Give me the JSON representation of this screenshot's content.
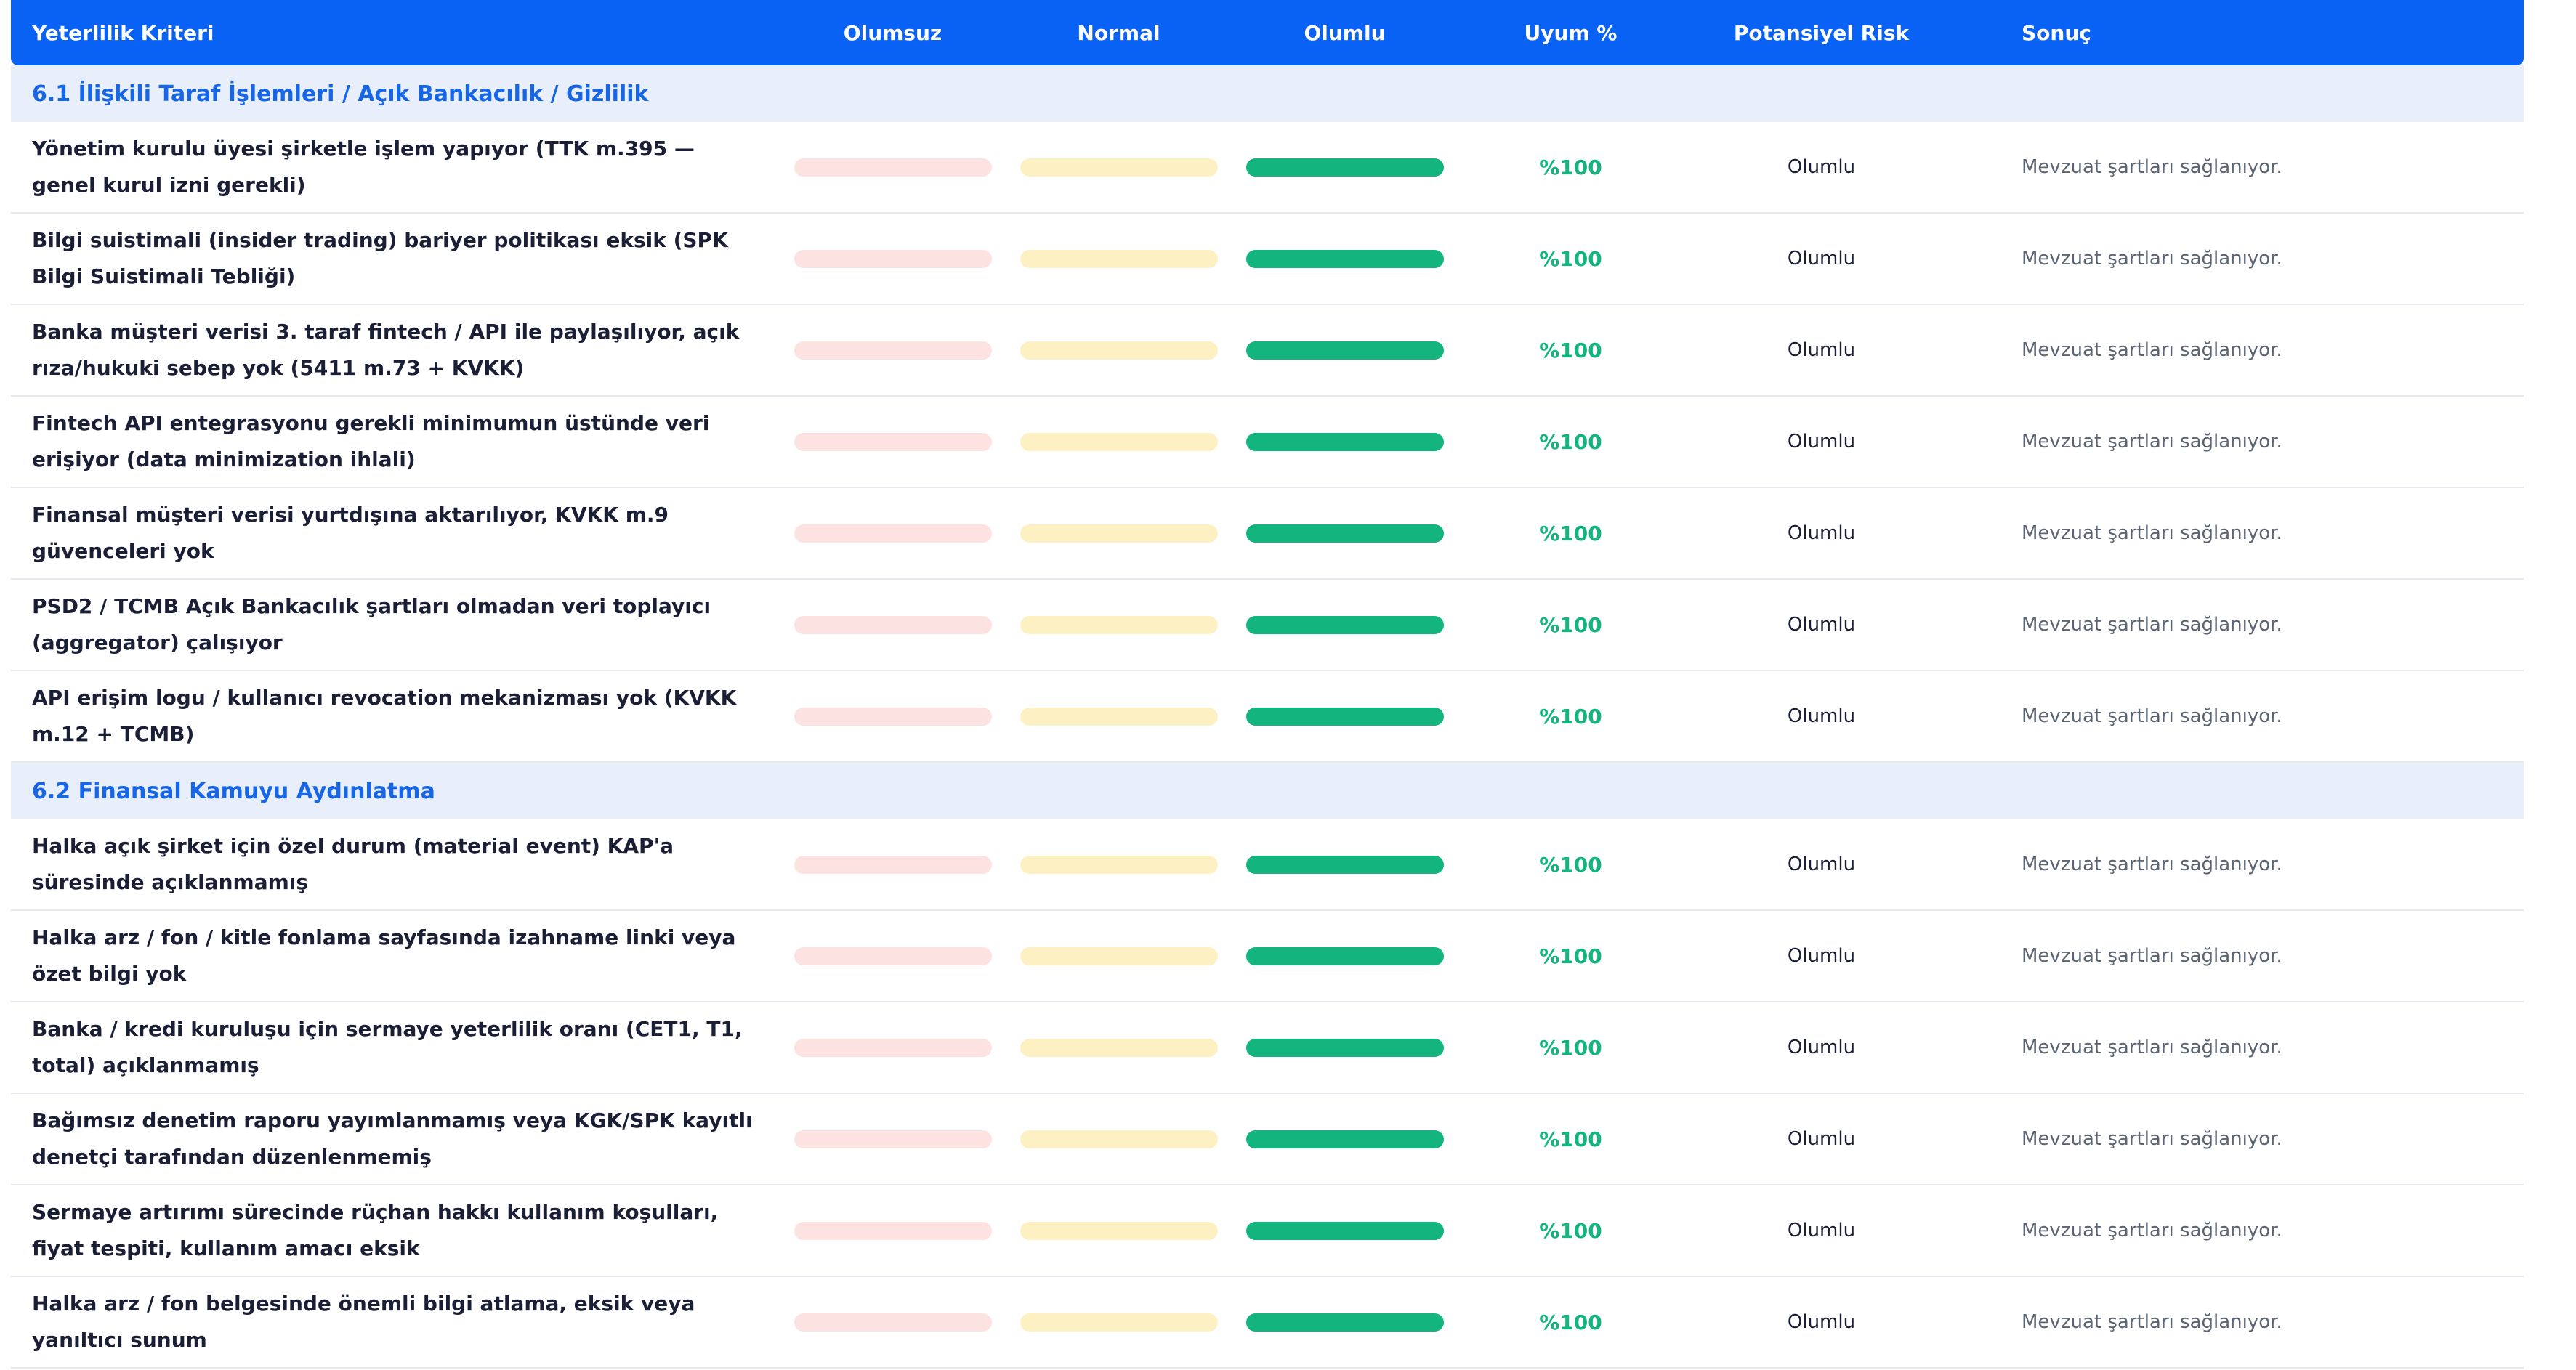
{
  "header": {
    "criteria": "Yeterlilik Kriteri",
    "negative": "Olumsuz",
    "normal": "Normal",
    "positive": "Olumlu",
    "compliance": "Uyum %",
    "risk": "Potansiyel Risk",
    "result": "Sonuç"
  },
  "colors": {
    "header_bg": "#0a62f4",
    "section_text": "#1666e6",
    "negative_bar": "#fde2e2",
    "normal_bar": "#fdf1c4",
    "positive_bar": "#14b47e"
  },
  "sections": [
    {
      "title": "6.1 İlişkili Taraf İşlemleri / Açık Bankacılık / Gizlilik",
      "rows": [
        {
          "criterion": "Yönetim kurulu üyesi şirketle işlem yapıyor (TTK m.395 — genel kurul izni gerekli)",
          "status": "positive",
          "compliance": "%100",
          "risk": "Olumlu",
          "result": "Mevzuat şartları sağlanıyor."
        },
        {
          "criterion": "Bilgi suistimali (insider trading) bariyer politikası eksik (SPK Bilgi Suistimali Tebliği)",
          "status": "positive",
          "compliance": "%100",
          "risk": "Olumlu",
          "result": "Mevzuat şartları sağlanıyor."
        },
        {
          "criterion": "Banka müşteri verisi 3. taraf fintech / API ile paylaşılıyor, açık rıza/hukuki sebep yok (5411 m.73 + KVKK)",
          "status": "positive",
          "compliance": "%100",
          "risk": "Olumlu",
          "result": "Mevzuat şartları sağlanıyor."
        },
        {
          "criterion": "Fintech API entegrasyonu gerekli minimumun üstünde veri erişiyor (data minimization ihlali)",
          "status": "positive",
          "compliance": "%100",
          "risk": "Olumlu",
          "result": "Mevzuat şartları sağlanıyor."
        },
        {
          "criterion": "Finansal müşteri verisi yurtdışına aktarılıyor, KVKK m.9 güvenceleri yok",
          "status": "positive",
          "compliance": "%100",
          "risk": "Olumlu",
          "result": "Mevzuat şartları sağlanıyor."
        },
        {
          "criterion": "PSD2 / TCMB Açık Bankacılık şartları olmadan veri toplayıcı (aggregator) çalışıyor",
          "status": "positive",
          "compliance": "%100",
          "risk": "Olumlu",
          "result": "Mevzuat şartları sağlanıyor."
        },
        {
          "criterion": "API erişim logu / kullanıcı revocation mekanizması yok (KVKK m.12 + TCMB)",
          "status": "positive",
          "compliance": "%100",
          "risk": "Olumlu",
          "result": "Mevzuat şartları sağlanıyor."
        }
      ]
    },
    {
      "title": "6.2 Finansal Kamuyu Aydınlatma",
      "rows": [
        {
          "criterion": "Halka açık şirket için özel durum (material event) KAP'a süresinde açıklanmamış",
          "status": "positive",
          "compliance": "%100",
          "risk": "Olumlu",
          "result": "Mevzuat şartları sağlanıyor."
        },
        {
          "criterion": "Halka arz / fon / kitle fonlama sayfasında izahname linki veya özet bilgi yok",
          "status": "positive",
          "compliance": "%100",
          "risk": "Olumlu",
          "result": "Mevzuat şartları sağlanıyor."
        },
        {
          "criterion": "Banka / kredi kuruluşu için sermaye yeterlilik oranı (CET1, T1, total) açıklanmamış",
          "status": "positive",
          "compliance": "%100",
          "risk": "Olumlu",
          "result": "Mevzuat şartları sağlanıyor."
        },
        {
          "criterion": "Bağımsız denetim raporu yayımlanmamış veya KGK/SPK kayıtlı denetçi tarafından düzenlenmemiş",
          "status": "positive",
          "compliance": "%100",
          "risk": "Olumlu",
          "result": "Mevzuat şartları sağlanıyor."
        },
        {
          "criterion": "Sermaye artırımı sürecinde rüçhan hakkı kullanım koşulları, fiyat tespiti, kullanım amacı eksik",
          "status": "positive",
          "compliance": "%100",
          "risk": "Olumlu",
          "result": "Mevzuat şartları sağlanıyor."
        },
        {
          "criterion": "Halka arz / fon belgesinde önemli bilgi atlama, eksik veya yanıltıcı sunum",
          "status": "positive",
          "compliance": "%100",
          "risk": "Olumlu",
          "result": "Mevzuat şartları sağlanıyor."
        }
      ]
    }
  ]
}
